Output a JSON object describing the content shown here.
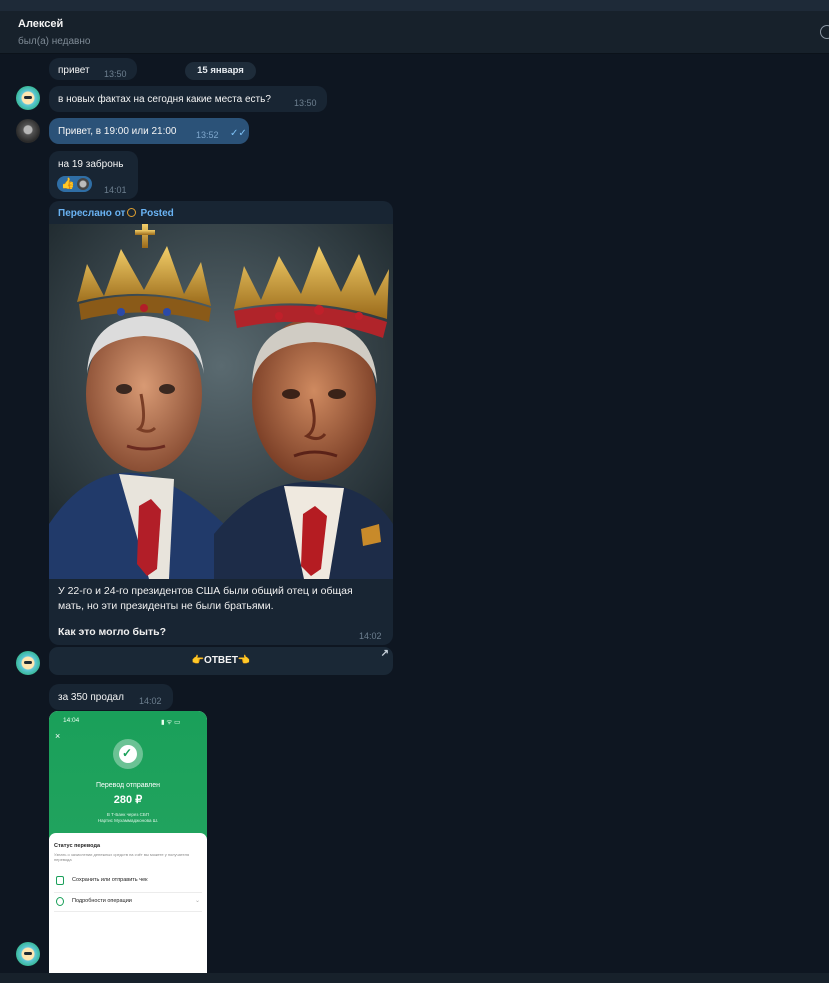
{
  "header": {
    "name": "Алексей",
    "status": "был(а) недавно"
  },
  "date_pill": "15 января",
  "messages": [
    {
      "text": "привет",
      "time": "13:50"
    },
    {
      "text": "в новых фактах на сегодня какие места есть?",
      "time": "13:50"
    },
    {
      "text": "Привет, в 19:00 или 21:00",
      "time": "13:52"
    },
    {
      "text": "на 19 забронь",
      "time": "14:01"
    },
    {
      "text": "за 350 продал",
      "time": "14:02"
    }
  ],
  "reaction": {
    "emoji": "👍"
  },
  "forwarded": {
    "prefix": "Переслано от",
    "channel": "Posted",
    "text": "У 22-го и 24-го президентов США были общий отец и общая мать, но эти президенты не были братьями.",
    "question": "Как это могло быть?",
    "time": "14:02",
    "button_label": "👉ОТВЕТ👈",
    "button_arrow": "↗"
  },
  "receipt": {
    "status_time": "14:04",
    "status_right": "▮ ᯤ ▭",
    "close": "×",
    "check_glyph": "✓",
    "title": "Перевод отправлен",
    "amount": "280 ₽",
    "line1": "В Т-Банк через СБП",
    "line2": "Нартис Мухаммаджонова Ш.",
    "status_title": "Статус перевода",
    "status_desc": "Узнать о зачислении денежных средств на счёт вы можете у получателя перевода",
    "row1": "Сохранить или отправить чек",
    "row2": "Подробности операции",
    "row2_chevron": "⌄"
  },
  "colors": {
    "chat_bg": "#0e1621",
    "bubble_in": "#182533",
    "bubble_out": "#2b5278",
    "link": "#6ab3f3",
    "receipt_green": "#1aa05a"
  }
}
